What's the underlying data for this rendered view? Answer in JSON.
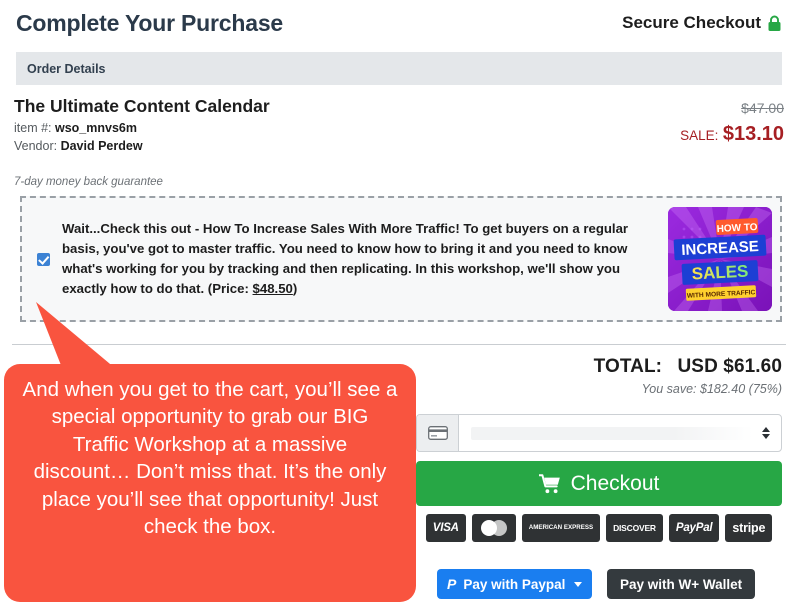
{
  "header": {
    "title": "Complete Your Purchase",
    "secure_label": "Secure Checkout",
    "lock_icon": "lock-icon",
    "lock_color": "#27a745"
  },
  "order_details": {
    "section_label": "Order Details"
  },
  "product": {
    "name": "The Ultimate Content Calendar",
    "item_label": "item #:",
    "item_number": "wso_mnvs6m",
    "vendor_label": "Vendor:",
    "vendor_name": "David Perdew",
    "original_price": "$47.00",
    "sale_label": "SALE:",
    "sale_price": "$13.10",
    "guarantee": "7-day money back guarantee"
  },
  "offer": {
    "checked": true,
    "text": "Wait...Check this out - How To Increase Sales With More Traffic! To get buyers on a regular basis, you've got to master traffic. You need to know how to bring it and you need to know what's working for you by tracking and then replicating. In this workshop, we'll show you exactly how to do that. (Price: ",
    "price": "$48.50",
    "text_suffix": ")",
    "thumb_line1": "HOW TO",
    "thumb_line2": "INCREASE",
    "thumb_line3": "SALES",
    "thumb_line4": "WITH MORE TRAFFIC"
  },
  "totals": {
    "total_label": "TOTAL:",
    "total_value": "USD $61.60",
    "savings": "You save: $182.40 (75%)"
  },
  "payment": {
    "select_placeholder": "",
    "select_value": "",
    "card_icon": "credit-card-icon",
    "spinner_icon": "updown-arrows-icon",
    "checkout_label": "Checkout",
    "cart_icon": "shopping-cart-icon",
    "checkout_color": "#27a745",
    "logos": [
      {
        "name": "visa",
        "label": "VISA"
      },
      {
        "name": "mastercard",
        "label": ""
      },
      {
        "name": "amex",
        "label": "AMERICAN EXPRESS"
      },
      {
        "name": "discover",
        "label": "DISCOVER"
      },
      {
        "name": "paypal",
        "label": "PayPal"
      },
      {
        "name": "stripe",
        "label": "stripe"
      }
    ],
    "paypal_button": "Pay with Paypal",
    "paypal_glyph": "P",
    "paypal_color": "#1a7ef0",
    "wallet_button": "Pay with W+ Wallet"
  },
  "annotation": {
    "text": "And when you get to the cart, you’ll see a special opportunity to grab our BIG Traffic Workshop at a massive discount… Don’t miss that. It’s the only place you’ll see that opportunity! Just check the box.",
    "color": "#f9543f"
  }
}
